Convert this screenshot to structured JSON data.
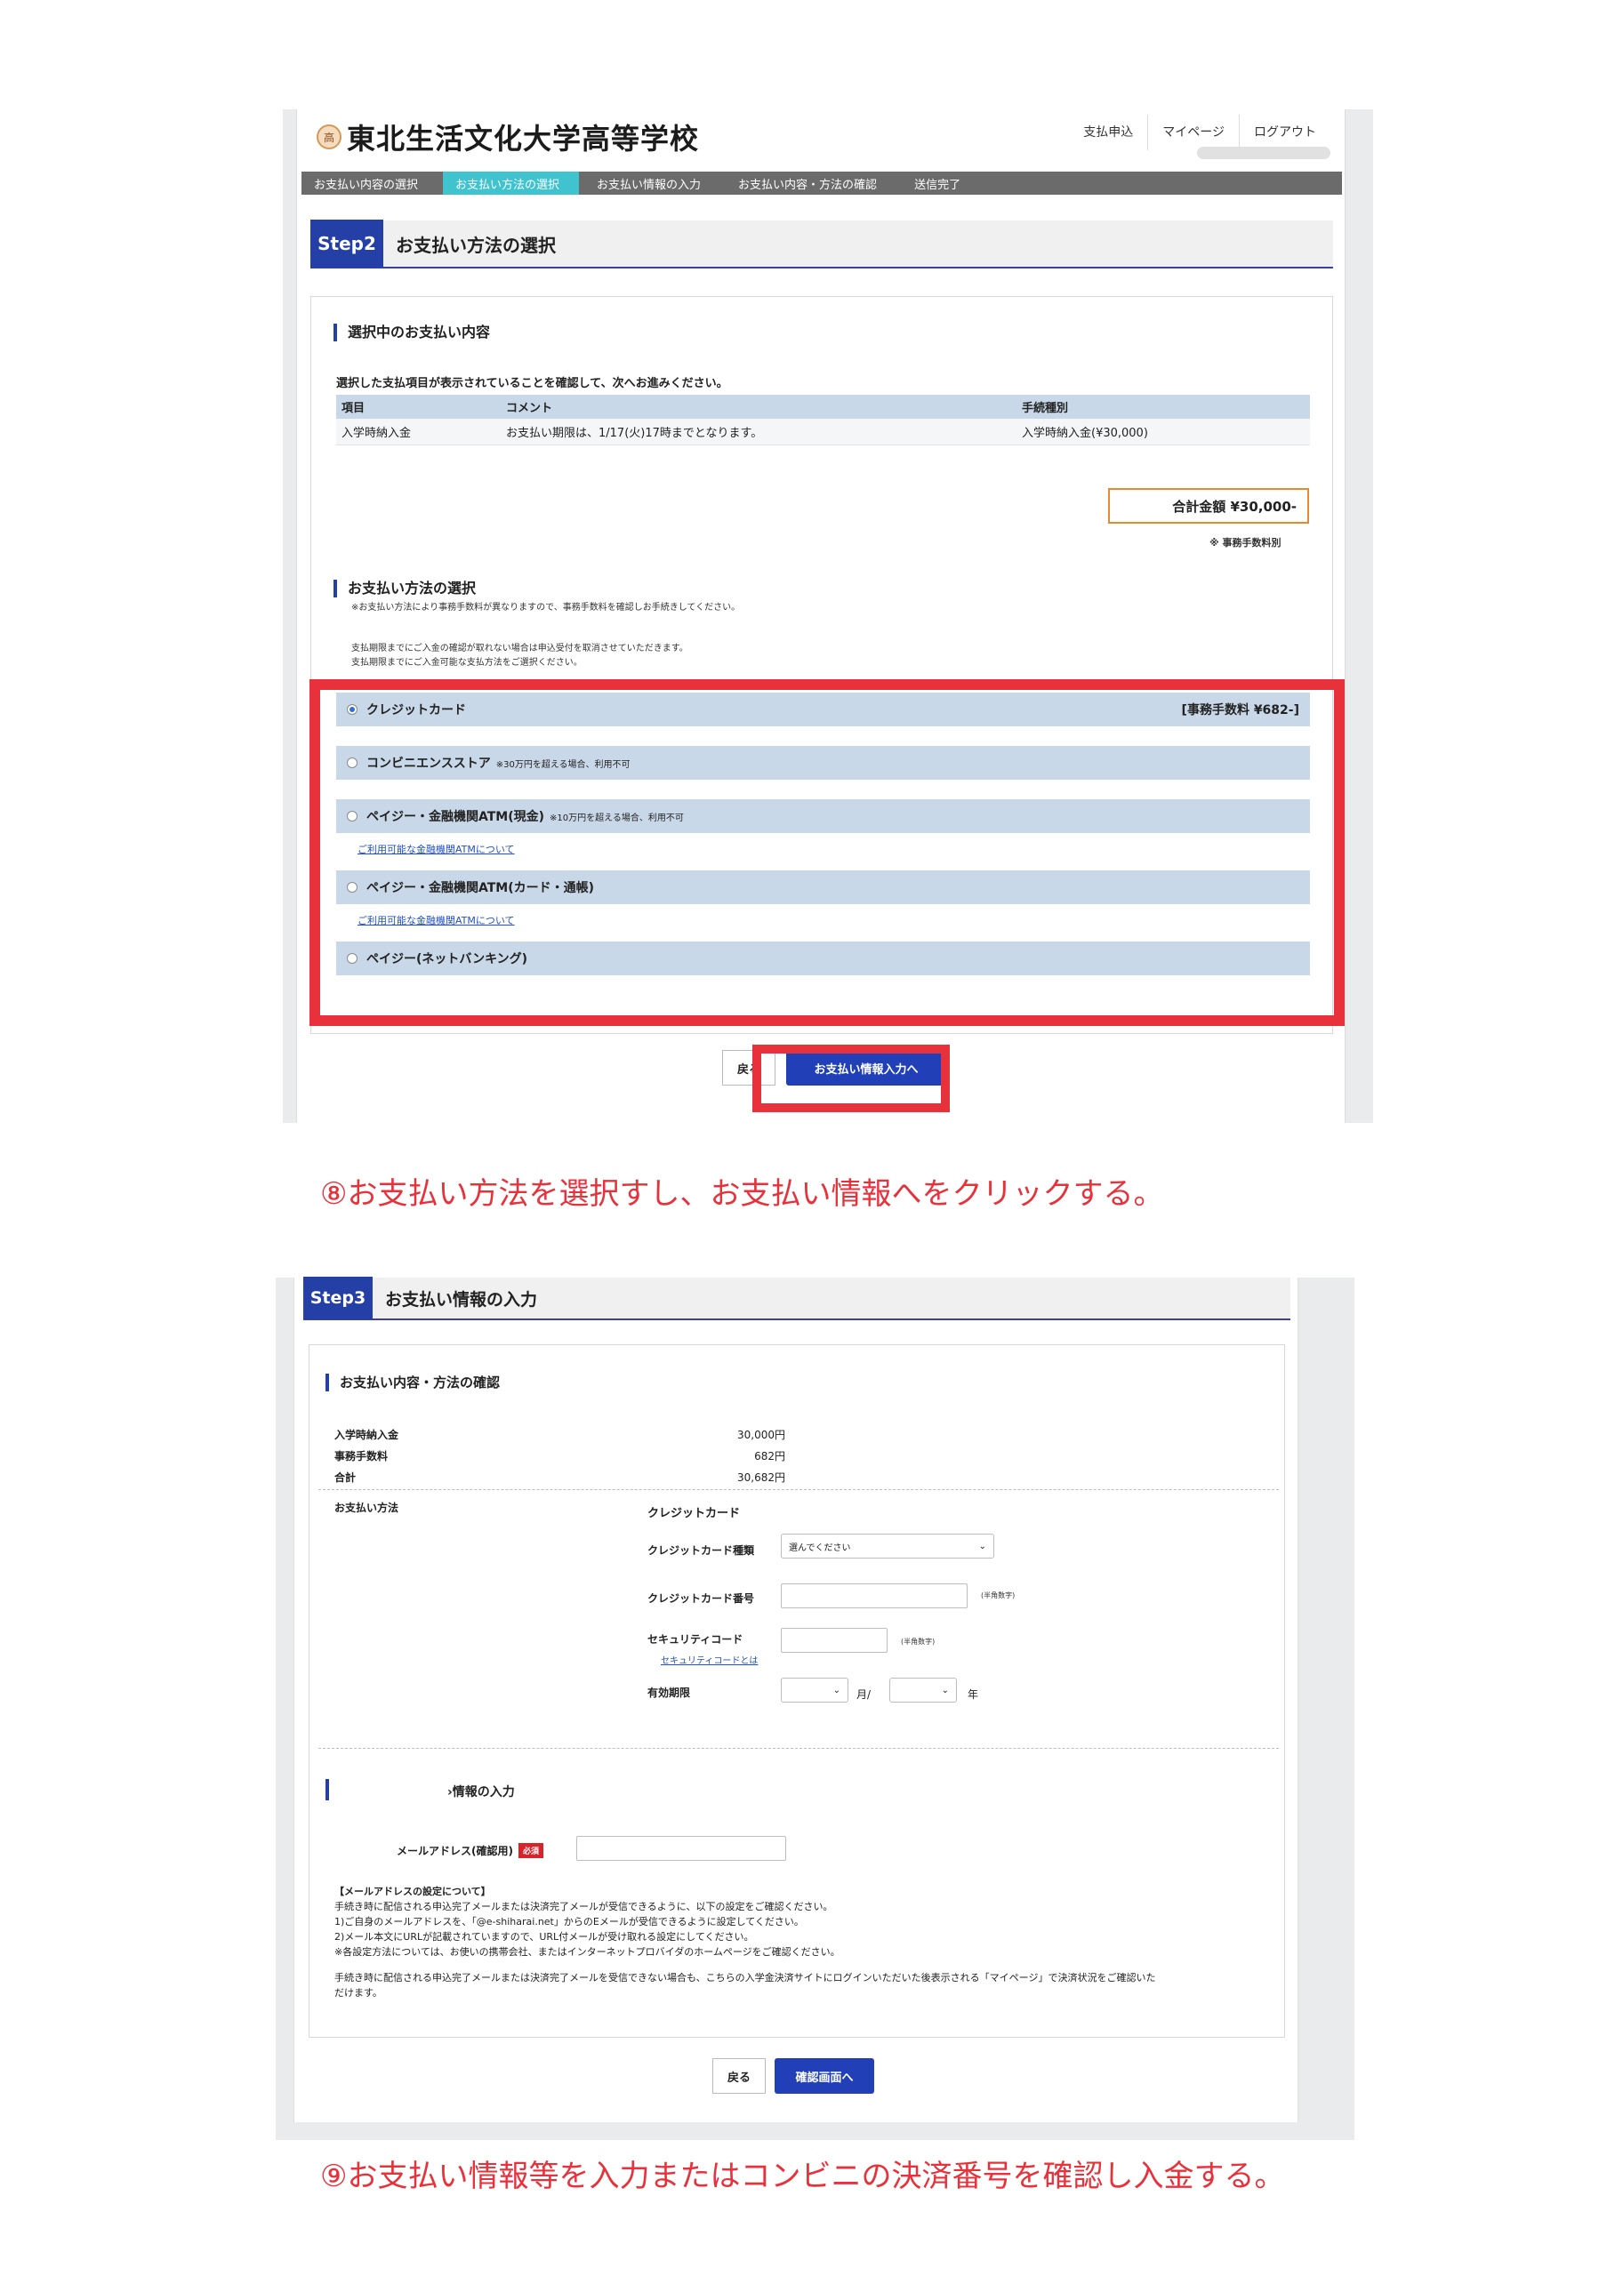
{
  "shot1": {
    "school_name": "東北生活文化大学高等学校",
    "logo_text": "高",
    "header_nav": [
      "支払申込",
      "マイページ",
      "ログアウト"
    ],
    "breadcrumbs": [
      {
        "label": "お支払い内容の選択",
        "active": false
      },
      {
        "label": "お支払い方法の選択",
        "active": true
      },
      {
        "label": "お支払い情報の入力",
        "active": false
      },
      {
        "label": "お支払い内容・方法の確認",
        "active": false
      },
      {
        "label": "送信完了",
        "active": false
      }
    ],
    "step_badge": "Step2",
    "step_title": "お支払い方法の選択",
    "selected_section_title": "選択中のお支払い内容",
    "selected_instruction": "選択した支払項目が表示されていることを確認して、次へお進みください。",
    "table_headers": [
      "項目",
      "コメント",
      "手続種別"
    ],
    "table_row": [
      "入学時納入金",
      "お支払い期限は、1/17(火)17時までとなります。",
      "入学時納入金(¥30,000)"
    ],
    "total_label": "合計金額 ¥30,000-",
    "fee_note": "※ 事務手数料別",
    "method_section_title": "お支払い方法の選択",
    "method_note1": "※お支払い方法により事務手数料が異なりますので、事務手数料を確認しお手続きしてください。",
    "method_note2": "支払期限までにご入金の確認が取れない場合は申込受付を取消させていただきます。",
    "method_note3": "支払期限までにご入金可能な支払方法をご選択ください。",
    "methods": [
      {
        "label": "クレジットカード",
        "note": "",
        "fee": "[事務手数料 ¥682-]",
        "selected": true,
        "link": ""
      },
      {
        "label": "コンビニエンスストア",
        "note": "※30万円を超える場合、利用不可",
        "fee": "",
        "selected": false,
        "link": ""
      },
      {
        "label": "ペイジー・金融機関ATM(現金)",
        "note": "※10万円を超える場合、利用不可",
        "fee": "",
        "selected": false,
        "link": "ご利用可能な金融機関ATMについて"
      },
      {
        "label": "ペイジー・金融機関ATM(カード・通帳)",
        "note": "",
        "fee": "",
        "selected": false,
        "link": "ご利用可能な金融機関ATMについて"
      },
      {
        "label": "ペイジー(ネットバンキング)",
        "note": "",
        "fee": "",
        "selected": false,
        "link": ""
      }
    ],
    "back_label": "戻る",
    "next_label": "お支払い情報入力へ"
  },
  "caption1": "⑧お支払い方法を選択すし、お支払い情報へをクリックする。",
  "shot2": {
    "step_badge": "Step3",
    "step_title": "お支払い情報の入力",
    "confirm_title": "お支払い内容・方法の確認",
    "lines": [
      {
        "label": "入学時納入金",
        "value": "30,000円"
      },
      {
        "label": "事務手数料",
        "value": "682円"
      },
      {
        "label": "合計",
        "value": "30,682円"
      }
    ],
    "method_label": "お支払い方法",
    "method_value": "クレジットカード",
    "card_type_label": "クレジットカード種類",
    "card_type_placeholder": "選んでください",
    "card_number_label": "クレジットカード番号",
    "half_width_digits": "(半角数字)",
    "security_label": "セキュリティコード",
    "security_half": "(半角数字)",
    "security_link": "セキュリティコードとは",
    "expiry_label": "有効期限",
    "month_unit": "月/",
    "year_unit": "年",
    "info_title": "›情報の入力",
    "email_label": "メールアドレス(確認用)",
    "required": "必須",
    "notes": [
      "【メールアドレスの設定について】",
      "手続き時に配信される申込完了メールまたは決済完了メールが受信できるように、以下の設定をご確認ください。",
      "1)ご自身のメールアドレスを、「@e-shiharai.net」からのEメールが受信できるように設定してください。",
      "2)メール本文にURLが記載されていますので、URL付メールが受け取れる設定にしてください。",
      "※各設定方法については、お使いの携帯会社、またはインターネットプロバイダのホームページをご確認ください。",
      "",
      "手続き時に配信される申込完了メールまたは決済完了メールを受信できない場合も、こちらの入学金決済サイトにログインいただいた後表示される「マイページ」で決済状況をご確認いた",
      "だけます。"
    ],
    "back_label": "戻る",
    "confirm_label": "確認画面へ"
  },
  "caption2": "⑨お支払い情報等を入力またはコンビニの決済番号を確認し入金する。",
  "colors": {
    "accent": "#243fa6",
    "highlight_red": "#e8313b",
    "total_border": "#e88a2a",
    "active_crumb": "#3fc3cf"
  }
}
